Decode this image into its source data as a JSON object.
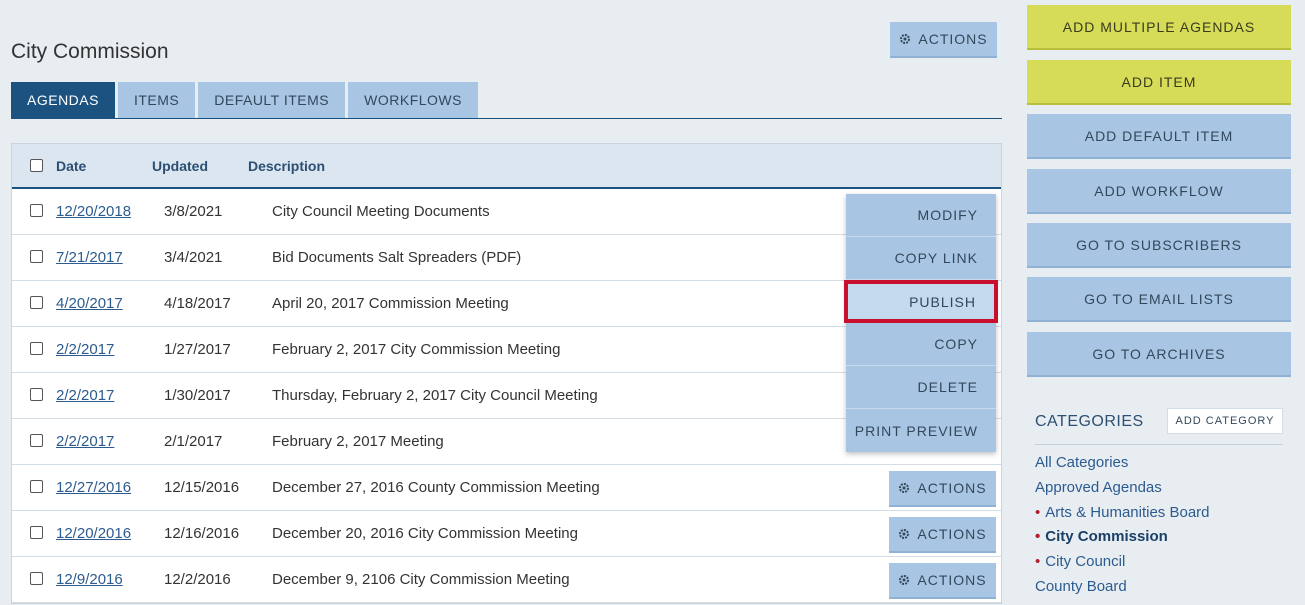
{
  "page": {
    "title": "City Commission",
    "actions_label": "ACTIONS"
  },
  "tabs": [
    {
      "label": "AGENDAS",
      "active": true
    },
    {
      "label": "ITEMS",
      "active": false
    },
    {
      "label": "DEFAULT ITEMS",
      "active": false
    },
    {
      "label": "WORKFLOWS",
      "active": false
    }
  ],
  "table": {
    "headers": {
      "date": "Date",
      "updated": "Updated",
      "description": "Description"
    },
    "rows": [
      {
        "date": "12/20/2018",
        "updated": "3/8/2021",
        "description": "City Council Meeting Documents"
      },
      {
        "date": "7/21/2017",
        "updated": "3/4/2021",
        "description": "Bid Documents Salt Spreaders (PDF)"
      },
      {
        "date": "4/20/2017",
        "updated": "4/18/2017",
        "description": "April 20, 2017 Commission Meeting"
      },
      {
        "date": "2/2/2017",
        "updated": "1/27/2017",
        "description": "February 2, 2017 City Commission Meeting"
      },
      {
        "date": "2/2/2017",
        "updated": "1/30/2017",
        "description": "Thursday, February 2, 2017 City Council Meeting"
      },
      {
        "date": "2/2/2017",
        "updated": "2/1/2017",
        "description": "February 2, 2017 Meeting"
      },
      {
        "date": "12/27/2016",
        "updated": "12/15/2016",
        "description": "December 27, 2016 County Commission Meeting",
        "actions": "ACTIONS"
      },
      {
        "date": "12/20/2016",
        "updated": "12/16/2016",
        "description": "December 20, 2016 City Commission Meeting",
        "actions": "ACTIONS"
      },
      {
        "date": "12/9/2016",
        "updated": "12/2/2016",
        "description": "December 9, 2106 City Commission Meeting",
        "actions": "ACTIONS"
      }
    ]
  },
  "dropdown": {
    "items": [
      "MODIFY",
      "COPY LINK",
      "PUBLISH",
      "COPY",
      "DELETE",
      "PRINT PREVIEW"
    ],
    "highlighted": "PUBLISH"
  },
  "sidebar": {
    "buttons": [
      "ADD MULTIPLE AGENDAS",
      "ADD ITEM",
      "ADD DEFAULT ITEM",
      "ADD WORKFLOW",
      "GO TO SUBSCRIBERS",
      "GO TO EMAIL LISTS",
      "GO TO ARCHIVES"
    ],
    "categories_title": "CATEGORIES",
    "add_category": "ADD CATEGORY",
    "categories": [
      {
        "label": "All Categories",
        "bullet": false,
        "active": false
      },
      {
        "label": "Approved Agendas",
        "bullet": false,
        "active": false
      },
      {
        "label": "Arts & Humanities Board",
        "bullet": true,
        "active": false
      },
      {
        "label": "City Commission",
        "bullet": true,
        "active": true
      },
      {
        "label": "City Council",
        "bullet": true,
        "active": false
      },
      {
        "label": "County Board",
        "bullet": false,
        "active": false
      }
    ]
  },
  "colors": {
    "accent": "#1b5280",
    "button_blue": "#a8c6e4",
    "button_yellow": "#d6dc58",
    "highlight": "#c8102e"
  },
  "icons": {
    "actions": "gear-icon",
    "bullet": "dot-bullet"
  }
}
